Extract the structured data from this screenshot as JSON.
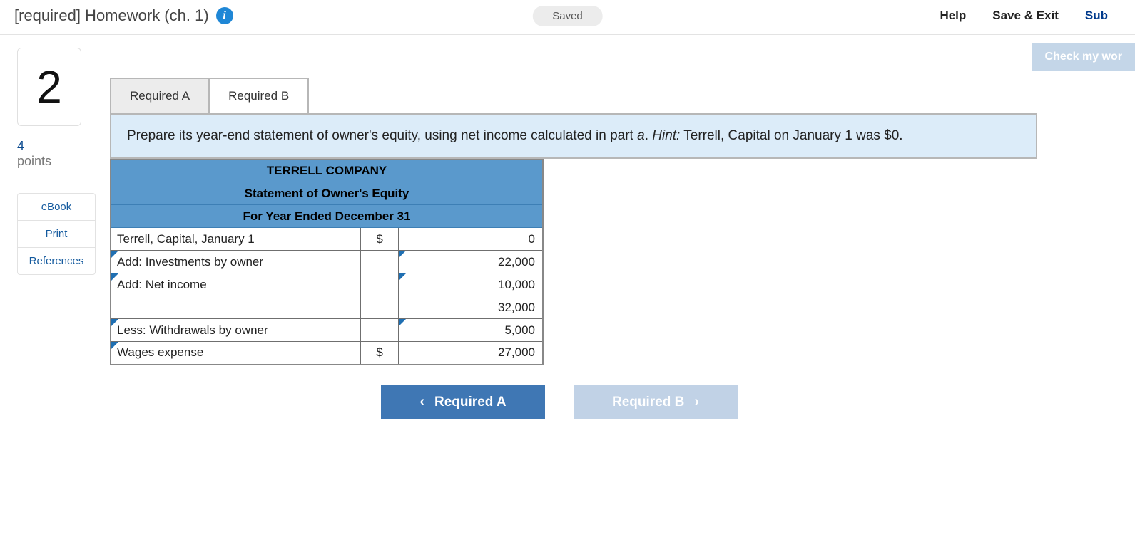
{
  "header": {
    "title": "[required] Homework (ch. 1)",
    "info_icon": "i",
    "saved_label": "Saved",
    "help": "Help",
    "save_exit": "Save & Exit",
    "submit": "Sub"
  },
  "sidebar": {
    "question_number": "2",
    "points_value": "4",
    "points_label": "points",
    "links": {
      "ebook": "eBook",
      "print": "Print",
      "references": "References"
    }
  },
  "main": {
    "check_label": "Check my wor",
    "tabs": {
      "a": "Required A",
      "b": "Required B"
    },
    "instruction_pre": "Prepare its year-end statement of owner's equity, using net income calculated in part ",
    "instruction_part": "a",
    "instruction_mid": ". ",
    "instruction_hint_label": "Hint:",
    "instruction_hint_text": " Terrell, Capital on January 1 was $0.",
    "table": {
      "company": "TERRELL COMPANY",
      "stmt_title": "Statement of Owner's Equity",
      "period": "For Year Ended December 31",
      "rows": [
        {
          "label": "Terrell, Capital, January 1",
          "cur": "$",
          "val": "0",
          "label_editable": false,
          "val_editable": false
        },
        {
          "label": "Add: Investments by owner",
          "cur": "",
          "val": "22,000",
          "label_editable": true,
          "val_editable": true
        },
        {
          "label": "Add: Net income",
          "cur": "",
          "val": "10,000",
          "label_editable": true,
          "val_editable": true
        },
        {
          "label": "",
          "cur": "",
          "val": "32,000",
          "label_editable": false,
          "val_editable": false
        },
        {
          "label": "Less: Withdrawals by owner",
          "cur": "",
          "val": "5,000",
          "label_editable": true,
          "val_editable": true
        },
        {
          "label": "Wages expense",
          "cur": "$",
          "val": "27,000",
          "label_editable": true,
          "val_editable": false
        }
      ]
    },
    "nav": {
      "prev": "Required A",
      "next": "Required B"
    }
  }
}
